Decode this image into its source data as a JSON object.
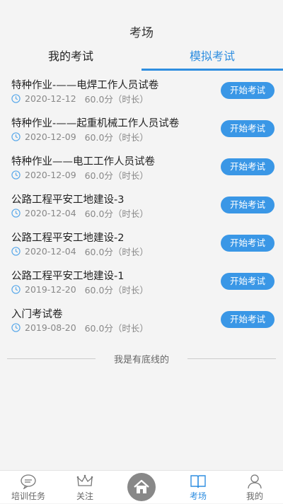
{
  "header": {
    "title": "考场"
  },
  "tabs": [
    {
      "label": "我的考试"
    },
    {
      "label": "模拟考试"
    }
  ],
  "exams": [
    {
      "title": "特种作业-——电焊工作人员试卷",
      "date": "2020-12-12",
      "meta": "60.0分（时长）",
      "button": "开始考试"
    },
    {
      "title": "特种作业-——起重机械工作人员试卷",
      "date": "2020-12-09",
      "meta": "60.0分（时长）",
      "button": "开始考试"
    },
    {
      "title": "特种作业——电工工作人员试卷",
      "date": "2020-12-09",
      "meta": "60.0分（时长）",
      "button": "开始考试"
    },
    {
      "title": "公路工程平安工地建设-3",
      "date": "2020-12-04",
      "meta": "60.0分（时长）",
      "button": "开始考试"
    },
    {
      "title": "公路工程平安工地建设-2",
      "date": "2020-12-04",
      "meta": "60.0分（时长）",
      "button": "开始考试"
    },
    {
      "title": "公路工程平安工地建设-1",
      "date": "2019-12-20",
      "meta": "60.0分（时长）",
      "button": "开始考试"
    },
    {
      "title": "入门考试卷",
      "date": "2019-08-20",
      "meta": "60.0分（时长）",
      "button": "开始考试"
    }
  ],
  "footer_text": "我是有底线的",
  "tabbar": [
    {
      "label": "培训任务",
      "icon": "chat-bubble-icon"
    },
    {
      "label": "关注",
      "icon": "crown-icon"
    },
    {
      "label": "",
      "icon": "home-icon"
    },
    {
      "label": "考场",
      "icon": "book-icon"
    },
    {
      "label": "我的",
      "icon": "person-icon"
    }
  ],
  "colors": {
    "accent": "#2f8ee0",
    "button": "#3a97e6"
  }
}
